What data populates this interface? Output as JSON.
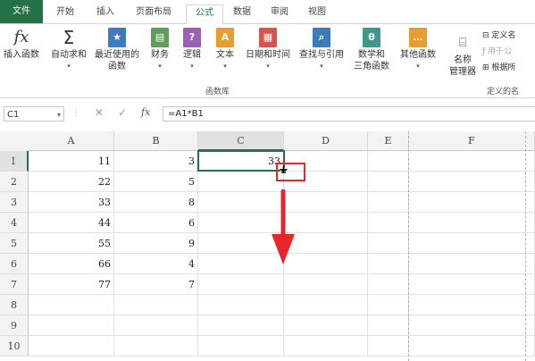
{
  "tabs": [
    {
      "label": "文件",
      "file": true
    },
    {
      "label": "开始"
    },
    {
      "label": "插入"
    },
    {
      "label": "页面布局"
    },
    {
      "label": "公式",
      "active": true
    },
    {
      "label": "数据"
    },
    {
      "label": "审阅"
    },
    {
      "label": "视图"
    }
  ],
  "ribbon": {
    "insert_function": "插入函数",
    "autosum": "自动求和",
    "recent_l1": "最近使用的",
    "recent_l2": "函数",
    "financial": "财务",
    "logical": "逻辑",
    "text": "文本",
    "datetime": "日期和时间",
    "lookup": "查找与引用",
    "math_l1": "数学和",
    "math_l2": "三角函数",
    "more": "其他函数",
    "group_label": "函数库",
    "name_mgr_l1": "名称",
    "name_mgr_l2": "管理器",
    "define_name": "定义名",
    "use_in_formula": "用于公",
    "create_from_sel": "根据所",
    "group_label2": "定义的名",
    "dropdown_arrow": "▾"
  },
  "formula_bar": {
    "name_box": "C1",
    "fx": "fx",
    "cancel": "✕",
    "enter": "✓",
    "formula": "=A1*B1"
  },
  "grid": {
    "columns": [
      "A",
      "B",
      "C",
      "D",
      "E",
      "F"
    ],
    "selected_column": "C",
    "selected_row": "1",
    "rows": [
      {
        "row": "1",
        "A": "11",
        "B": "3",
        "C": "33"
      },
      {
        "row": "2",
        "A": "22",
        "B": "5",
        "C": ""
      },
      {
        "row": "3",
        "A": "33",
        "B": "8",
        "C": ""
      },
      {
        "row": "4",
        "A": "44",
        "B": "6",
        "C": ""
      },
      {
        "row": "5",
        "A": "55",
        "B": "9",
        "C": ""
      },
      {
        "row": "6",
        "A": "66",
        "B": "4",
        "C": ""
      },
      {
        "row": "7",
        "A": "77",
        "B": "7",
        "C": ""
      },
      {
        "row": "8",
        "A": "",
        "B": "",
        "C": ""
      },
      {
        "row": "9",
        "A": "",
        "B": "",
        "C": ""
      },
      {
        "row": "10",
        "A": "",
        "B": "",
        "C": ""
      }
    ]
  },
  "annotation": {
    "color": "#e8262a",
    "cursor_glyph": "+"
  },
  "colors": {
    "accent": "#217346",
    "icon_blue": "#3d7bbd",
    "icon_green": "#5e9e5a",
    "icon_purple": "#9b5fb5",
    "icon_orange": "#e99d2e",
    "icon_red": "#d9534f",
    "icon_teal": "#3d9a8b"
  }
}
